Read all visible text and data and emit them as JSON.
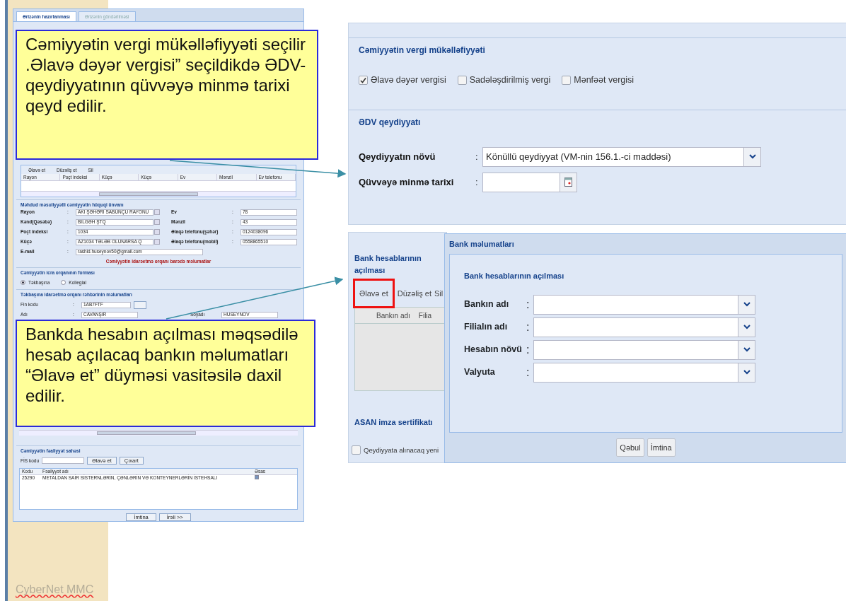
{
  "slide": {
    "footer": "CyberNet MMC"
  },
  "form_screenshot": {
    "tabs": [
      {
        "label": "Ərizənin hazırlanması",
        "selected": true
      },
      {
        "label": "Ərizənin göndərilməsi",
        "selected": false
      }
    ],
    "grid_toolbar": [
      "Əlavə et",
      "Düzəliş et",
      "Sil"
    ],
    "grid_columns": [
      "Rayon",
      "Poçt indeksi",
      "Küçə",
      "Küçə",
      "Ev",
      "Mənzil",
      "Ev telefonu"
    ],
    "address": {
      "legend": "Məhdud məsuliyyətli cəmiyyətin hüquqi ünvanı",
      "left": [
        {
          "label": "Rayon",
          "colon": ":",
          "value": "AKİ ŞƏHƏRİ SABUNÇU RAYONU",
          "kind": "select"
        },
        {
          "label": "Kənd(Qəsəbə)",
          "colon": ":",
          "value": "BİLGƏH ŞTQ",
          "kind": "select"
        },
        {
          "label": "Poçt indeksi",
          "colon": ":",
          "value": "1034",
          "kind": "select"
        },
        {
          "label": "Küçə",
          "colon": ":",
          "value": "AZ1034 TƏLƏB OLUNARSA Q",
          "kind": "select"
        }
      ],
      "right": [
        {
          "label": "Ev",
          "colon": ":",
          "value": "78",
          "kind": "text"
        },
        {
          "label": "Mənzil",
          "colon": ":",
          "value": "43",
          "kind": "text"
        },
        {
          "label": "Əlaqə telefonu(şəhər)",
          "colon": ":",
          "value": "0124038096",
          "kind": "text"
        },
        {
          "label": "Əlaqə telefonu(mobil)",
          "colon": ":",
          "value": "0558865510",
          "kind": "text"
        }
      ],
      "email": {
        "label": "E-mail",
        "colon": ":",
        "value": "rashid.huseynov50@gmail.com"
      }
    },
    "management_heading": "Cəmiyyətin idarəetmə orqanı barədə məlumatlar",
    "exec_form": {
      "legend": "Cəmiyyətin icra orqanının forması",
      "options": [
        {
          "label": "Təkbaşına",
          "selected": true
        },
        {
          "label": "Kollegial",
          "selected": false
        }
      ]
    },
    "director": {
      "legend": "Təkbaşına idarəetmə orqanı rəhbərinin məlumatları",
      "fin_label": "Fin kodu",
      "fin_colon": ":",
      "fin_value": "1AB7FTF",
      "name_label": "Adı",
      "name_colon": ":",
      "name_value": "CAVANŞİR",
      "surname_label": "Soyadı",
      "surname_value": "HÜSEYNOV"
    },
    "activity": {
      "legend": "Cəmiyyətin fəaliyyət sahəsi",
      "code_label": "FİS kodu",
      "buttons": [
        "Əlavə et",
        "Çıxart"
      ],
      "columns": [
        "Kodu",
        "Fəaliyyət adı",
        "Əsas"
      ],
      "rows": [
        {
          "code": "25290",
          "name": "METALDAN SAİR SİSTERNLƏRİN, ÇƏNLƏRİN VƏ KONTEYNERLƏRİN İSTEHSALI",
          "main": true
        }
      ]
    },
    "buttons": [
      "İmtina",
      "İrəli >>"
    ]
  },
  "callouts": [
    {
      "text": "Cəmiyyətin vergi mükəlləfiyyəti seçilir .Əlavə dəyər vergisi” seçildikdə ƏDV-qeydiyyatının qüvvəyə minmə tarixi qeyd edilir."
    },
    {
      "text": "Bankda hesabın açılması məqsədilə hesab açılacaq bankın məlumatları “Əlavə et” düyməsi vasitəsilə daxil edilir."
    }
  ],
  "tax_panel": {
    "legend": "Cəmiyyətin vergi mükəlləfiyyəti",
    "checkboxes": [
      {
        "label": "Əlavə dəyər vergisi",
        "checked": true
      },
      {
        "label": "Sadələşdirilmiş vergi",
        "checked": false
      },
      {
        "label": "Mənfəət vergisi",
        "checked": false
      }
    ],
    "vat": {
      "legend": "ƏDV qeydiyyatı",
      "fields": [
        {
          "label": "Qeydiyyatın növü",
          "colon": ":",
          "value": "Könüllü qeydiyyat (VM-nin 156.1.-ci maddəsi)",
          "kind": "select"
        },
        {
          "label": "Qüvvəyə minmə tarixi",
          "colon": ":",
          "kind": "date"
        }
      ]
    }
  },
  "bank_panel": {
    "legend": "Bank hesablarının açılması",
    "toolbar": [
      {
        "label": "Əlavə et",
        "highlighted": true
      },
      {
        "label": "Düzəliş et",
        "highlighted": false
      },
      {
        "label": "Sil",
        "highlighted": false
      }
    ],
    "columns": [
      "Bankın adı",
      "Filia"
    ],
    "asan": {
      "legend": "ASAN imza sertifikatı",
      "checkbox": {
        "label": "Qeydiyyata alınacaq yeni",
        "checked": false
      }
    }
  },
  "dialog": {
    "title": "Bank məlumatları",
    "legend": "Bank hesablarının açılması",
    "fields": [
      {
        "label": "Bankın adı",
        "colon": ":"
      },
      {
        "label": "Filialın adı",
        "colon": ":"
      },
      {
        "label": "Hesabın növü",
        "colon": ":"
      },
      {
        "label": "Valyuta",
        "colon": ":"
      }
    ],
    "buttons": [
      "Qəbul",
      "İmtina"
    ]
  }
}
